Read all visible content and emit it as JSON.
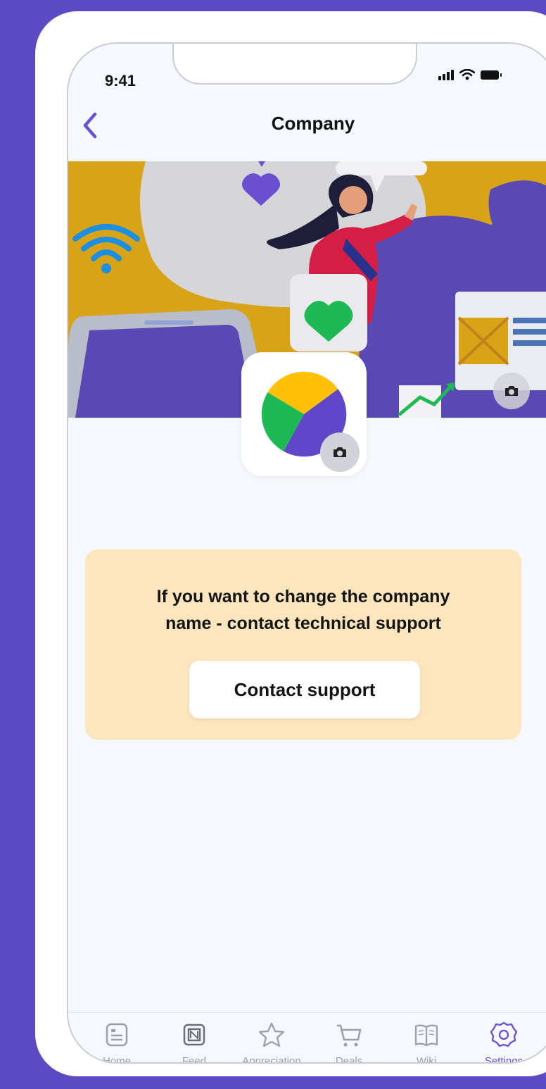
{
  "status_bar": {
    "time": "9:41"
  },
  "header": {
    "title": "Company"
  },
  "notice": {
    "line1": "If you want to change the company",
    "line2": "name - contact technical support",
    "button_label": "Contact support"
  },
  "tab_bar": {
    "items": [
      {
        "label": "Home",
        "icon": "home-icon",
        "active": false
      },
      {
        "label": "Feed",
        "icon": "feed-icon",
        "active": false
      },
      {
        "label": "Appreciation",
        "icon": "star-icon",
        "active": false
      },
      {
        "label": "Deals",
        "icon": "cart-icon",
        "active": false
      },
      {
        "label": "Wiki",
        "icon": "book-icon",
        "active": false
      },
      {
        "label": "Settings",
        "icon": "gear-icon",
        "active": true
      }
    ]
  },
  "colors": {
    "background": "#5b4ac4",
    "accent": "#6a4fd0",
    "notice_bg": "#fde6bd",
    "logo_yellow": "#ffc107",
    "logo_green": "#1db954",
    "logo_purple": "#6046c8"
  }
}
